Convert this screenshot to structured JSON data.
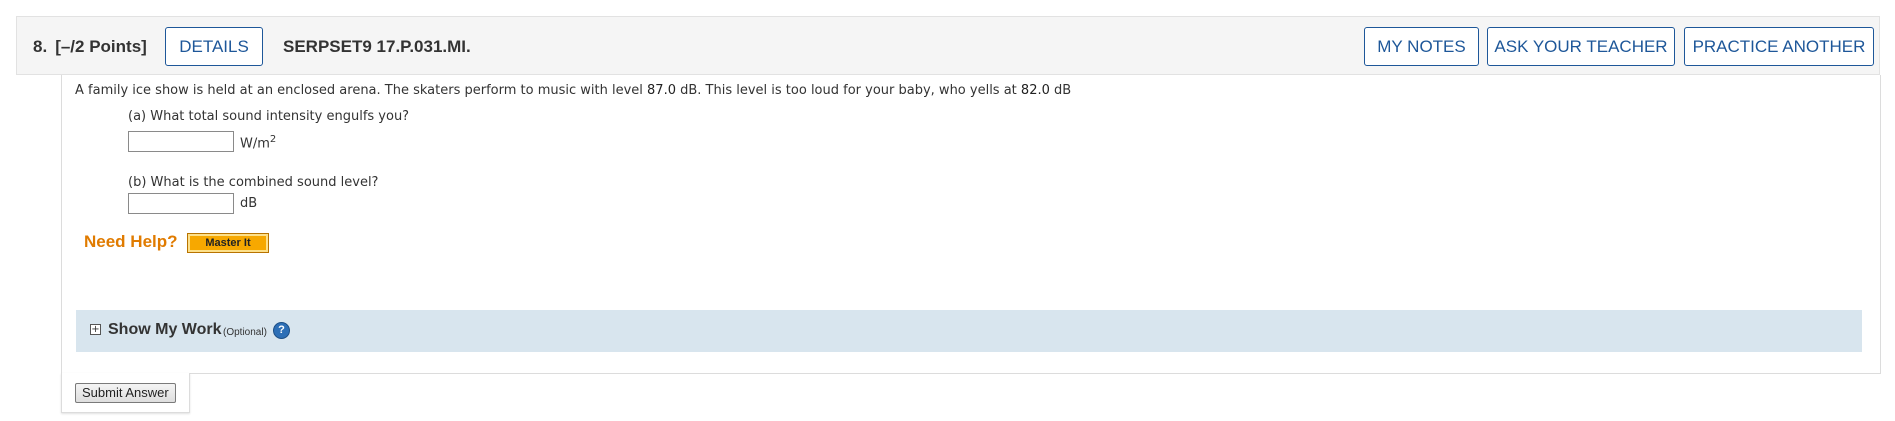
{
  "header": {
    "question_number": "8.",
    "points": "[–/2 Points]",
    "details_label": "DETAILS",
    "question_code": "SERPSET9 17.P.031.MI.",
    "my_notes_label": "MY NOTES",
    "ask_teacher_label": "ASK YOUR TEACHER",
    "practice_another_label": "PRACTICE ANOTHER"
  },
  "problem": {
    "text_1": "A family ice show is held at an enclosed arena. The skaters perform to music with level ",
    "music_level": "87.0",
    "text_2": " dB. This level is too loud for your baby, who yells at ",
    "baby_level": "82.0",
    "text_3": " dB"
  },
  "parts": {
    "a": {
      "question": "(a) What total sound intensity engulfs you?",
      "value": "",
      "unit_base": "W/m",
      "unit_exp": "2"
    },
    "b": {
      "question": "(b) What is the combined sound level?",
      "value": "",
      "unit": "dB"
    }
  },
  "help": {
    "need_help_label": "Need Help?",
    "master_it_label": "Master It"
  },
  "show_work": {
    "expand_symbol": "+",
    "title": "Show My Work",
    "optional_label": "(Optional)",
    "help_symbol": "?"
  },
  "submit": {
    "label": "Submit Answer"
  },
  "colors": {
    "accent_blue": "#1e5799",
    "need_help_orange": "#e07b00",
    "master_it_bg": "#f7a800",
    "show_work_bg": "#d8e5ee"
  }
}
